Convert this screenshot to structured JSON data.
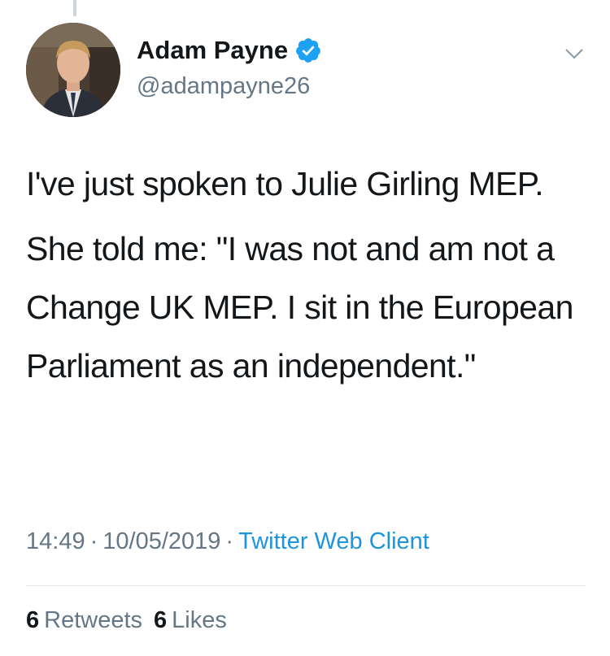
{
  "author": {
    "display_name": "Adam Payne",
    "handle": "@adampayne26",
    "verified": true
  },
  "icons": {
    "verified": "verified-badge-icon",
    "menu": "chevron-down-icon"
  },
  "tweet": {
    "paragraphs": [
      "I've just spoken to Julie Girling MEP.",
      "She told me: \"I was not and am not a Change UK MEP. I sit in the European Parliament as an independent.\""
    ],
    "time": "14:49",
    "date": "10/05/2019",
    "source": "Twitter Web Client"
  },
  "stats": {
    "retweets_count": "6",
    "retweets_label": "Retweets",
    "likes_count": "6",
    "likes_label": "Likes"
  },
  "colors": {
    "verified_blue": "#1da1f2",
    "link_blue": "#1b95e0",
    "secondary_text": "#657786",
    "divider": "#e1e8ed"
  }
}
